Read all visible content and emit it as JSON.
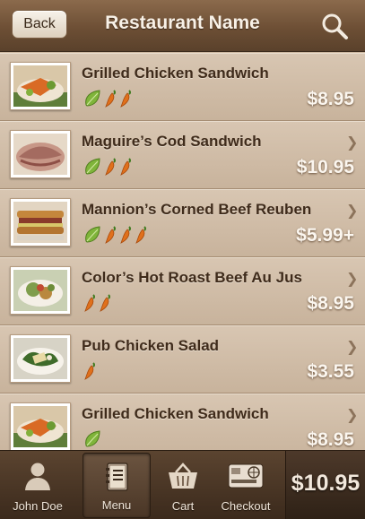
{
  "header": {
    "back_label": "Back",
    "title": "Restaurant Name",
    "search_icon": "search-icon"
  },
  "menu_items": [
    {
      "name": "Grilled Chicken Sandwich",
      "price": "$8.95",
      "veg": true,
      "spice_level": 2,
      "image": "chicken-dish-photo",
      "chevron": ""
    },
    {
      "name": "Maguire’s Cod Sandwich",
      "price": "$10.95",
      "veg": true,
      "spice_level": 2,
      "image": "cod-sandwich-photo",
      "chevron": "❯"
    },
    {
      "name": "Mannion’s Corned Beef Reuben",
      "price": "$5.99+",
      "veg": true,
      "spice_level": 3,
      "image": "reuben-photo",
      "chevron": "❯"
    },
    {
      "name": "Color’s Hot Roast Beef Au Jus",
      "price": "$8.95",
      "veg": false,
      "spice_level": 2,
      "image": "roast-beef-photo",
      "chevron": "❯"
    },
    {
      "name": "Pub Chicken Salad",
      "price": "$3.55",
      "veg": false,
      "spice_level": 1,
      "image": "salad-photo",
      "chevron": "❯"
    },
    {
      "name": "Grilled Chicken Sandwich",
      "price": "$8.95",
      "veg": true,
      "spice_level": 0,
      "image": "chicken-dish-photo",
      "chevron": "❯"
    }
  ],
  "tabbar": {
    "tabs": [
      {
        "label": "John Doe",
        "icon": "person-icon",
        "active": false
      },
      {
        "label": "Menu",
        "icon": "menu-book-icon",
        "active": true
      },
      {
        "label": "Cart",
        "icon": "basket-icon",
        "active": false
      },
      {
        "label": "Checkout",
        "icon": "credit-card-icon",
        "active": false
      }
    ],
    "total": "$10.95"
  },
  "colors": {
    "header_bg": "#6d4f35",
    "row_bg": "#d0bca6",
    "veg_green": "#7fb43a",
    "pepper_orange": "#e0701c",
    "price_text": "#fbf6ef"
  }
}
